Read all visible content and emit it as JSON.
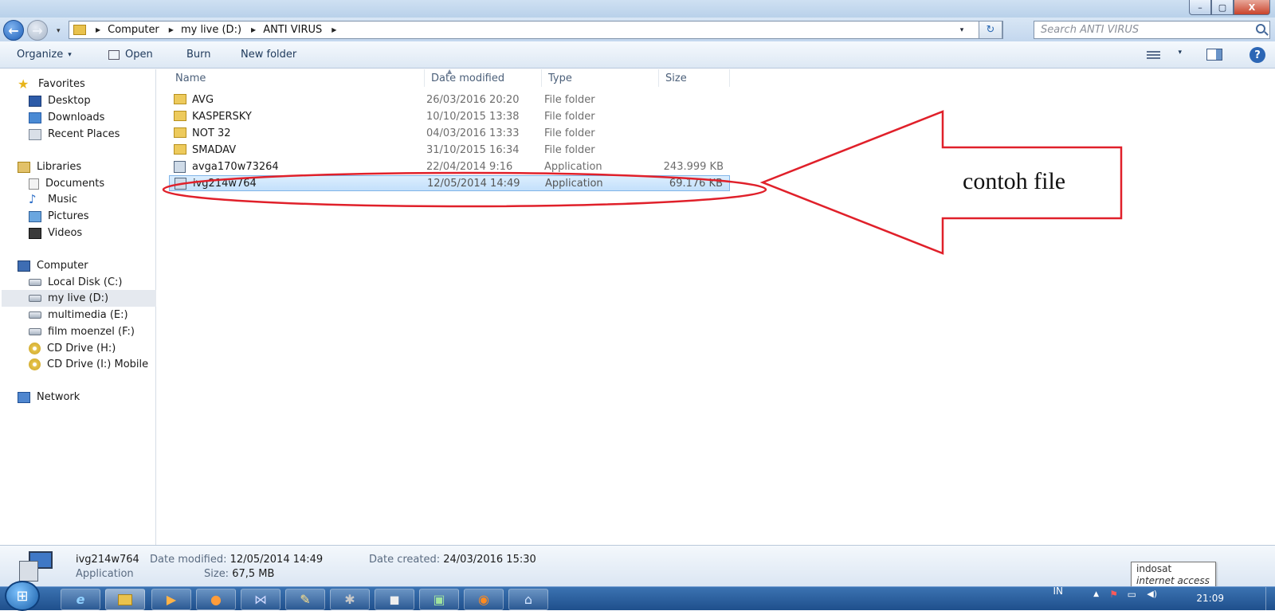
{
  "window": {
    "min_label": "–",
    "max_label": "▢",
    "close_label": "X"
  },
  "nav": {
    "back": "←",
    "forward": "→",
    "recent": "▾"
  },
  "address": {
    "crumbs": [
      "Computer",
      "my live (D:)",
      "ANTI VIRUS"
    ],
    "dropdown": "▾",
    "refresh": "↻"
  },
  "search": {
    "placeholder": "Search ANTI VIRUS"
  },
  "toolbar": {
    "organize": "Organize",
    "organize_arrow": "▾",
    "open": "Open",
    "burn": "Burn",
    "new_folder": "New folder",
    "views_arrow": "▾",
    "help": "?"
  },
  "sidebar": {
    "favorites": {
      "label": "Favorites",
      "items": [
        "Desktop",
        "Downloads",
        "Recent Places"
      ]
    },
    "libraries": {
      "label": "Libraries",
      "items": [
        "Documents",
        "Music",
        "Pictures",
        "Videos"
      ]
    },
    "computer": {
      "label": "Computer",
      "items": [
        "Local Disk (C:)",
        "my live (D:)",
        "multimedia (E:)",
        "film moenzel (F:)",
        "CD Drive (H:)",
        "CD Drive (I:) Mobile"
      ]
    },
    "network": {
      "label": "Network"
    }
  },
  "columns": {
    "name": "Name",
    "date": "Date modified",
    "type": "Type",
    "size": "Size"
  },
  "files": [
    {
      "name": "AVG",
      "date": "26/03/2016 20:20",
      "type": "File folder",
      "size": "",
      "kind": "folder"
    },
    {
      "name": "KASPERSKY",
      "date": "10/10/2015 13:38",
      "type": "File folder",
      "size": "",
      "kind": "folder"
    },
    {
      "name": "NOT 32",
      "date": "04/03/2016 13:33",
      "type": "File folder",
      "size": "",
      "kind": "folder"
    },
    {
      "name": "SMADAV",
      "date": "31/10/2015 16:34",
      "type": "File folder",
      "size": "",
      "kind": "folder"
    },
    {
      "name": "avga170w73264",
      "date": "22/04/2014 9:16",
      "type": "Application",
      "size": "243.999 KB",
      "kind": "app"
    },
    {
      "name": "ivg214w764",
      "date": "12/05/2014 14:49",
      "type": "Application",
      "size": "69.176 KB",
      "kind": "app",
      "selected": true
    }
  ],
  "annotation": {
    "text": "contoh file",
    "color": "#e0202a"
  },
  "details": {
    "name": "ivg214w764",
    "type": "Application",
    "date_modified_label": "Date modified:",
    "date_modified": "12/05/2014 14:49",
    "date_created_label": "Date created:",
    "date_created": "24/03/2016 15:30",
    "size_label": "Size:",
    "size": "67,5 MB"
  },
  "tooltip": {
    "line1": "indosat",
    "line2": "internet access"
  },
  "taskbar": {
    "start": "⊞",
    "language": "IN",
    "clock": "21:09",
    "tray_up": "▲",
    "tray_flag": "⚑",
    "tray_net": "▭",
    "tray_vol": "◀)"
  },
  "colors": {
    "accent": "#1e5fb8",
    "selection": "#cce4fb",
    "taskbar": "#2a5f9f"
  }
}
